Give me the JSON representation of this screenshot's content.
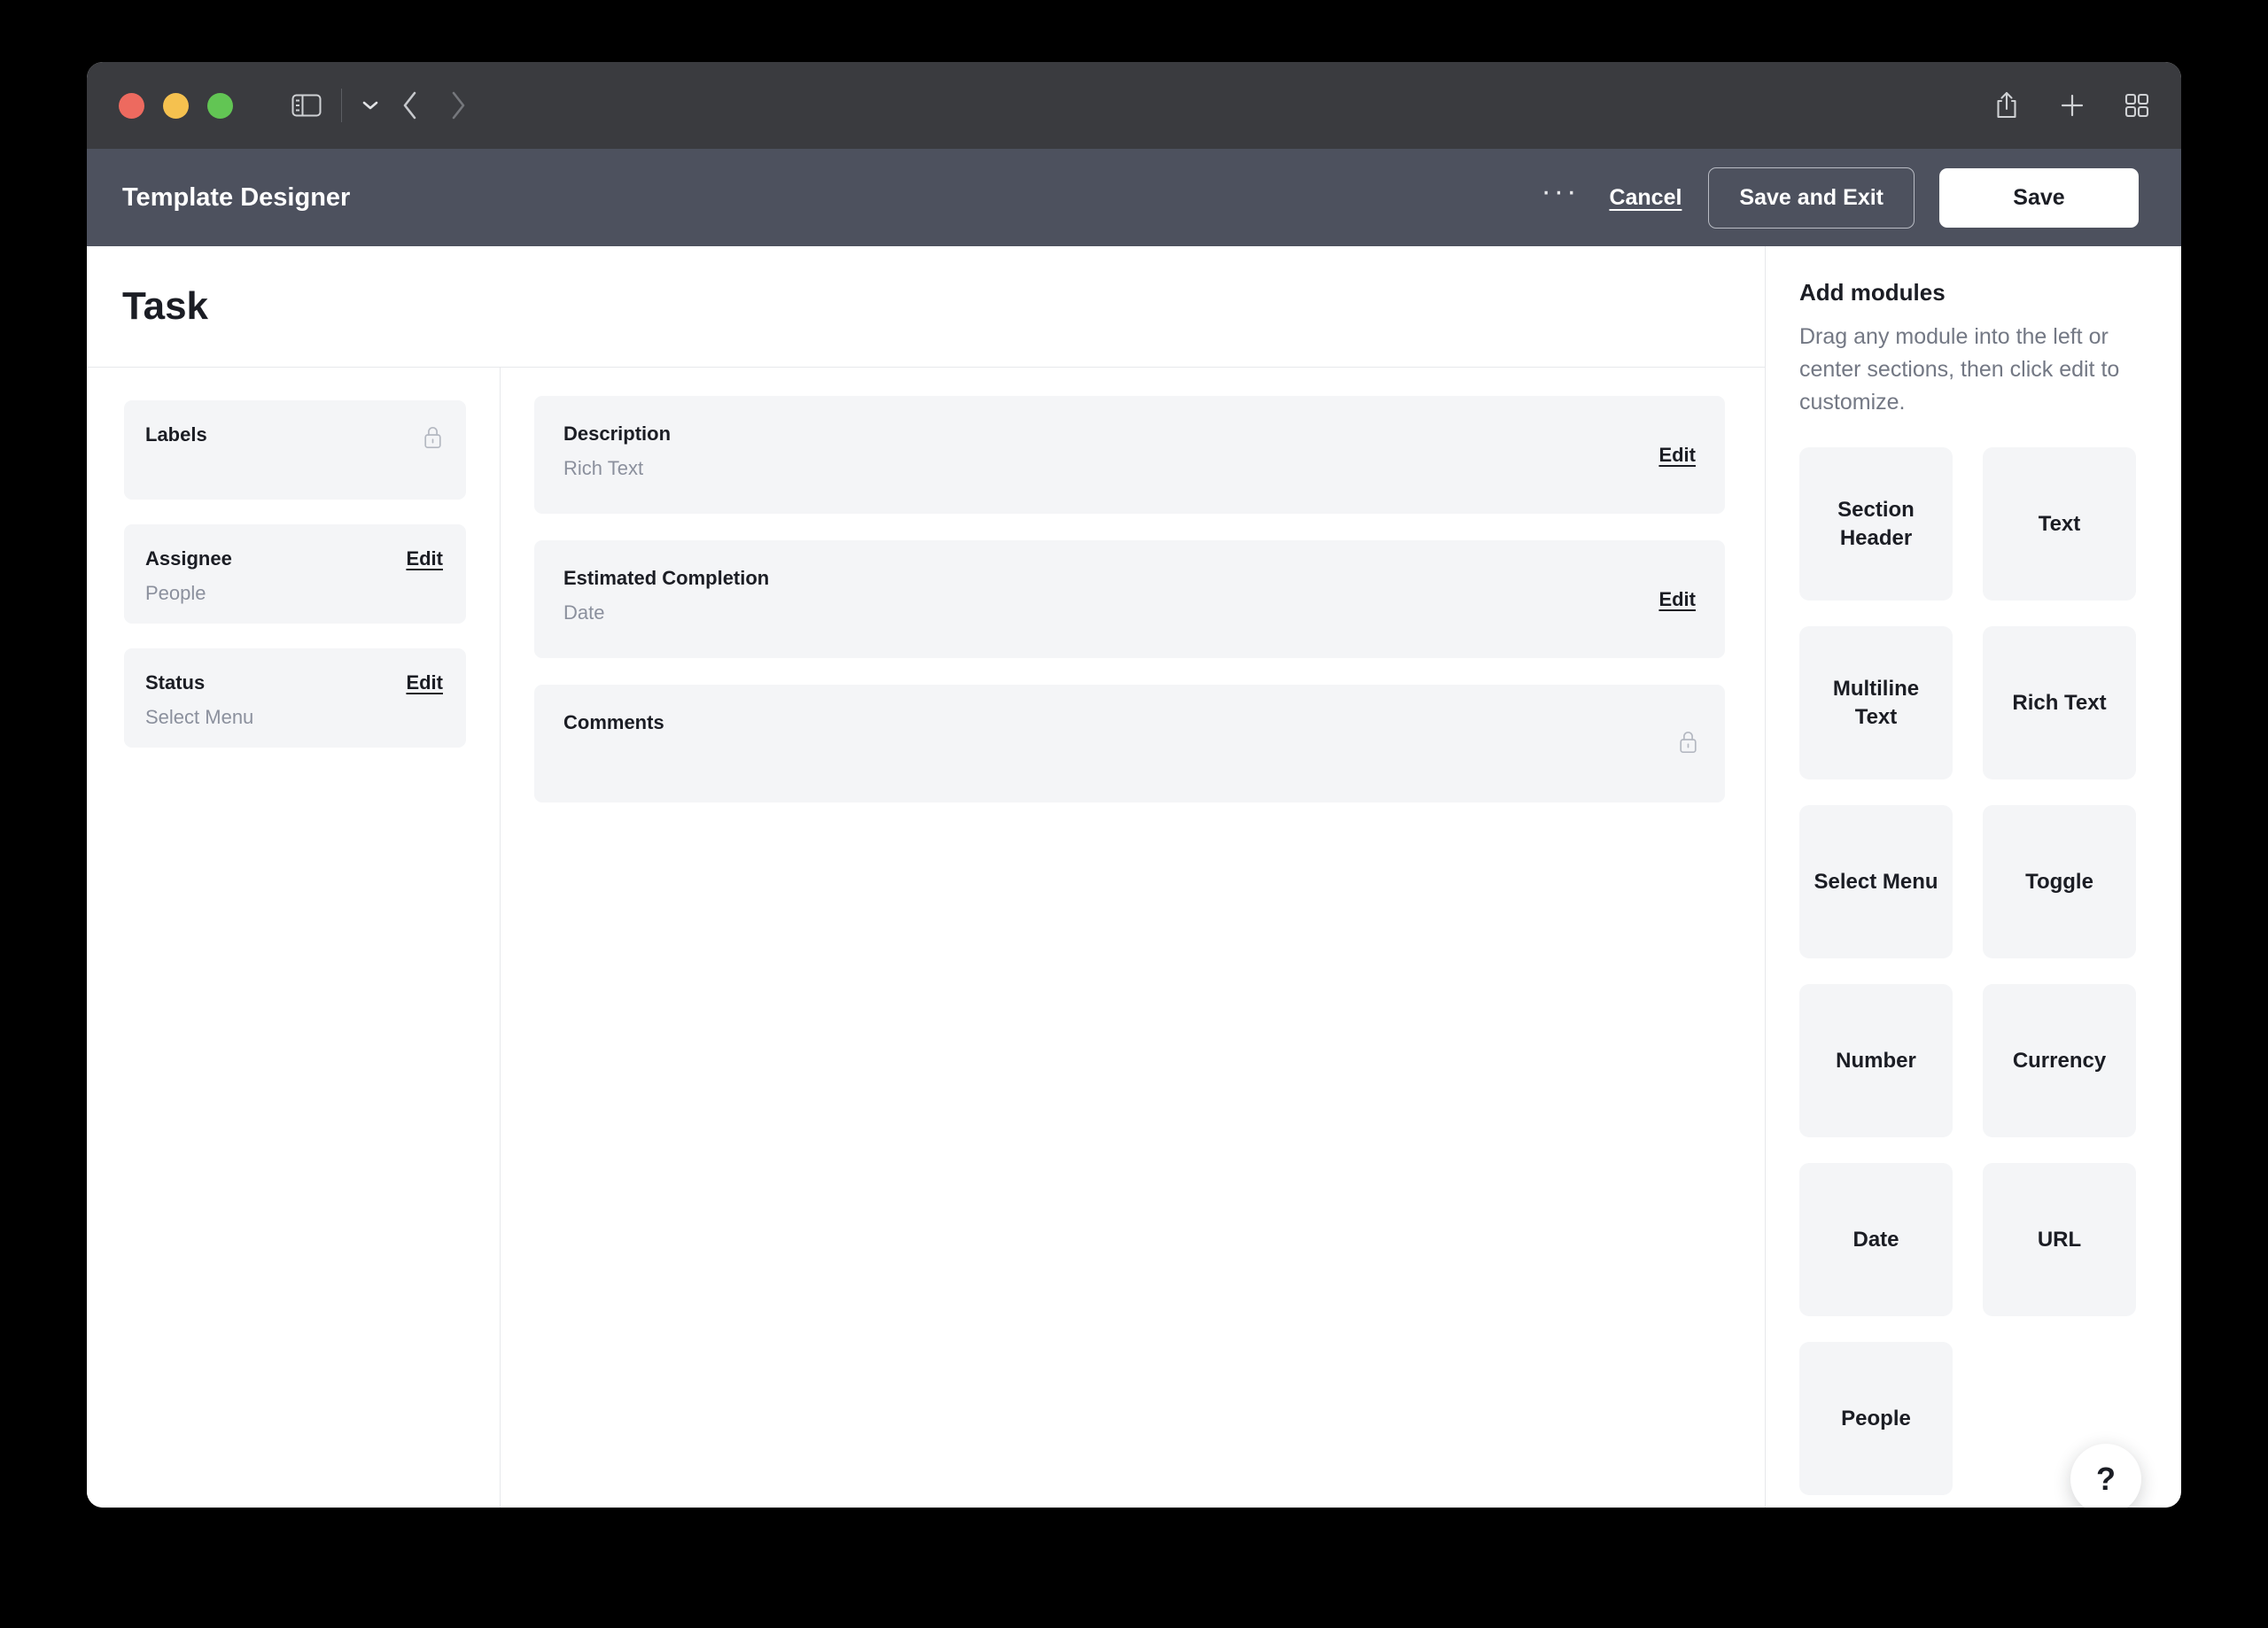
{
  "titlebar": {
    "traffic_lights": [
      "close",
      "minimize",
      "maximize"
    ],
    "sidebar_toggle_icon": "sidebar-toggle-icon",
    "chevron_down_icon": "chevron-down-icon",
    "back_icon": "chevron-left-icon",
    "forward_icon": "chevron-right-icon",
    "share_icon": "share-icon",
    "new_tab_icon": "plus-icon",
    "tab_overview_icon": "grid-icon"
  },
  "header": {
    "title": "Template Designer",
    "more_label": "···",
    "cancel_label": "Cancel",
    "save_and_exit_label": "Save and Exit",
    "save_label": "Save"
  },
  "canvas": {
    "page_title": "Task",
    "left_modules": [
      {
        "label": "Labels",
        "type": "",
        "action": "lock",
        "action_label": ""
      },
      {
        "label": "Assignee",
        "type": "People",
        "action": "edit",
        "action_label": "Edit"
      },
      {
        "label": "Status",
        "type": "Select Menu",
        "action": "edit",
        "action_label": "Edit"
      }
    ],
    "center_modules": [
      {
        "label": "Description",
        "type": "Rich Text",
        "action": "edit",
        "action_label": "Edit"
      },
      {
        "label": "Estimated Completion",
        "type": "Date",
        "action": "edit",
        "action_label": "Edit"
      },
      {
        "label": "Comments",
        "type": "",
        "action": "lock",
        "action_label": ""
      }
    ]
  },
  "right_panel": {
    "title": "Add modules",
    "description": "Drag any module into the left or center sections, then click edit to customize.",
    "tiles": [
      {
        "label": "Section Header"
      },
      {
        "label": "Text"
      },
      {
        "label": "Multiline Text"
      },
      {
        "label": "Rich Text"
      },
      {
        "label": "Select Menu"
      },
      {
        "label": "Toggle"
      },
      {
        "label": "Number"
      },
      {
        "label": "Currency"
      },
      {
        "label": "Date"
      },
      {
        "label": "URL"
      },
      {
        "label": "People"
      }
    ],
    "help_label": "?"
  },
  "colors": {
    "titlebar_bg": "#3a3b3f",
    "header_bg": "#4d515e",
    "card_bg": "#f4f5f7",
    "text_primary": "#1b1d24",
    "text_muted": "#8b909d",
    "divider": "#e7e8eb"
  }
}
